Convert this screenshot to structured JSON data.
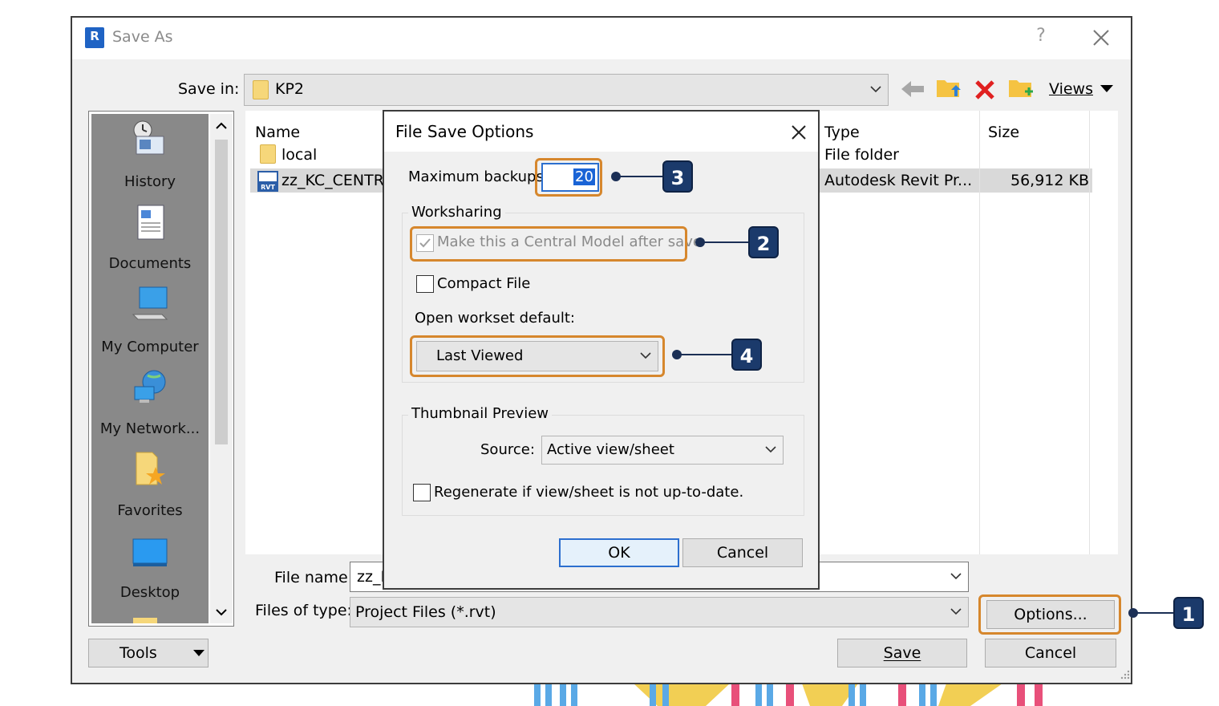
{
  "window": {
    "title": "Save As",
    "help": "?",
    "save_in_label": "Save in:",
    "save_in_value": "KP2",
    "views_label": "Views",
    "file_name_label": "File name:",
    "file_name_value": "zz_K",
    "files_of_type_label": "Files of type:",
    "files_of_type_value": "Project Files (*.rvt)",
    "tools_label": "Tools",
    "options_label": "Options...",
    "save_label": "Save",
    "cancel_label": "Cancel"
  },
  "places": [
    {
      "label": "History",
      "icon": "history-icon"
    },
    {
      "label": "Documents",
      "icon": "documents-icon"
    },
    {
      "label": "My Computer",
      "icon": "computer-icon"
    },
    {
      "label": "My Network...",
      "icon": "network-icon"
    },
    {
      "label": "Favorites",
      "icon": "favorites-icon"
    },
    {
      "label": "Desktop",
      "icon": "desktop-icon"
    }
  ],
  "file_list": {
    "columns": [
      "Name",
      "Type",
      "Size"
    ],
    "rows": [
      {
        "name": "local",
        "type": "File folder",
        "size": ""
      },
      {
        "name": "zz_KC_CENTRA",
        "type": "Autodesk Revit Pr...",
        "size": "56,912 KB"
      }
    ]
  },
  "dialog": {
    "title": "File Save Options",
    "max_backups_label": "Maximum backups:",
    "max_backups_value": "20",
    "worksharing_legend": "Worksharing",
    "make_central_label": "Make this a Central Model after save",
    "make_central_checked": true,
    "compact_file_label": "Compact File",
    "open_workset_label": "Open workset default:",
    "open_workset_value": "Last Viewed",
    "thumbnail_legend": "Thumbnail Preview",
    "source_label": "Source:",
    "source_value": "Active view/sheet",
    "regenerate_label": "Regenerate if view/sheet is not up-to-date.",
    "ok_label": "OK",
    "cancel_label": "Cancel"
  },
  "callouts": [
    "1",
    "2",
    "3",
    "4"
  ],
  "colors": {
    "highlight": "#d6872d",
    "callout": "#1b3a6b",
    "delete_red": "#e02020",
    "folder_yellow": "#f6d77a"
  }
}
